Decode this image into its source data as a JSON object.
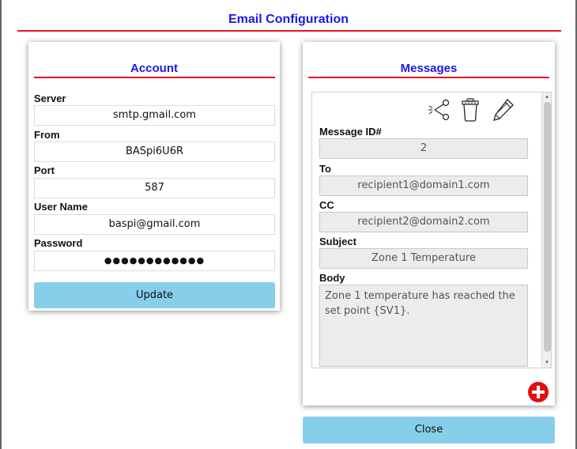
{
  "page": {
    "title": "Email Configuration"
  },
  "account": {
    "title": "Account",
    "server_label": "Server",
    "server_value": "smtp.gmail.com",
    "from_label": "From",
    "from_value": "BASpi6U6R",
    "port_label": "Port",
    "port_value": "587",
    "username_label": "User Name",
    "username_value": "baspi@gmail.com",
    "password_label": "Password",
    "password_value": "●●●●●●●●●●●●",
    "update_label": "Update"
  },
  "messages": {
    "title": "Messages",
    "message_id_label": "Message ID#",
    "message_id_value": "2",
    "to_label": "To",
    "to_value": "recipient1@domain1.com",
    "cc_label": "CC",
    "cc_value": "recipient2@domain2.com",
    "subject_label": "Subject",
    "subject_value": "Zone 1 Temperature",
    "body_label": "Body",
    "body_value": "Zone 1 temperature has reached the set point {SV1}.",
    "icons": [
      "share-icon",
      "trash-icon",
      "pencil-icon",
      "add-icon"
    ]
  },
  "footer": {
    "close_label": "Close"
  },
  "colors": {
    "title_blue": "#1a1ae6",
    "rule_red": "#e0141e",
    "button_blue": "#87ceeb",
    "add_red": "#e01010"
  }
}
